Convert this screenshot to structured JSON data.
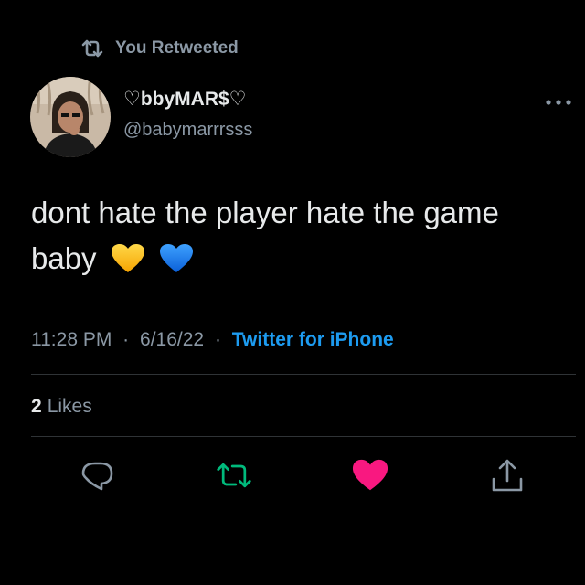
{
  "retweet_context": {
    "label": "You Retweeted"
  },
  "author": {
    "display_name": "♡bbyMAR$♡",
    "handle": "@babymarrrsss"
  },
  "tweet": {
    "text": "dont hate the player hate the game baby",
    "emojis": [
      "yellow-heart",
      "blue-heart"
    ],
    "time": "11:28 PM",
    "date": "6/16/22",
    "separator": "·",
    "source": "Twitter for iPhone"
  },
  "stats": {
    "likes_count": "2",
    "likes_label": "Likes"
  },
  "actions": [
    "reply-icon",
    "retweet-icon",
    "like-icon",
    "share-icon"
  ],
  "colors": {
    "background": "#000000",
    "text": "#e7e9ea",
    "secondary_text": "#8b98a5",
    "link": "#1d9bf0",
    "retweeted": "#00ba7c",
    "liked": "#f91880",
    "divider": "#2f3336"
  }
}
